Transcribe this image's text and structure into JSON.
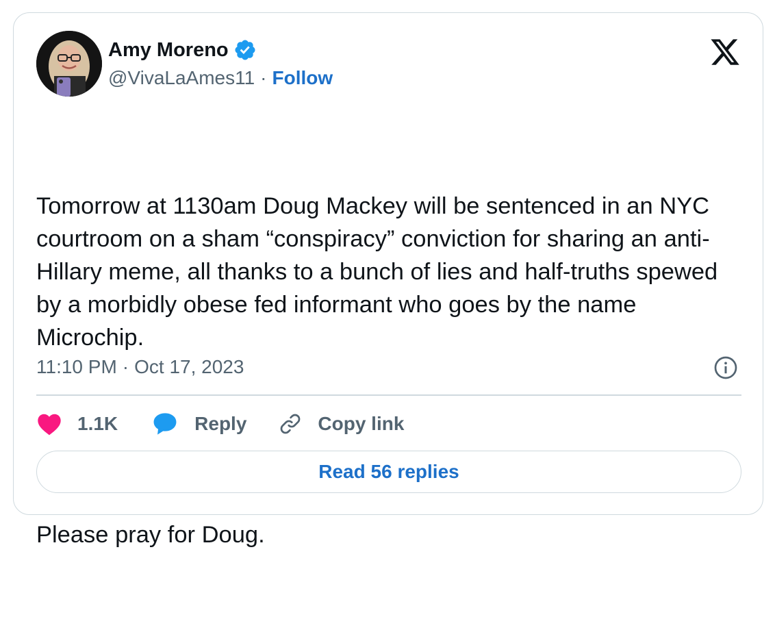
{
  "author": {
    "display_name": "Amy Moreno",
    "handle": "@VivaLaAmes11",
    "separator": "·",
    "follow_label": "Follow",
    "verified": true
  },
  "tweet": {
    "paragraphs": [
      "Tomorrow at 1130am Doug Mackey will be sentenced in an NYC courtroom on a sham “conspiracy” conviction for sharing an anti-Hillary meme, all thanks to a bunch of lies and half-truths spewed by a morbidly obese fed informant who goes by the name Microchip.",
      "Please pray for Doug."
    ],
    "time": "11:10 PM",
    "separator": "·",
    "date": "Oct 17, 2023"
  },
  "actions": {
    "like_count": "1.1K",
    "reply_label": "Reply",
    "copy_link_label": "Copy link"
  },
  "read_replies_label": "Read 56 replies",
  "icons": {
    "verified": "verified-badge-icon",
    "logo": "x-logo-icon",
    "info": "info-icon",
    "like": "heart-icon",
    "reply": "speech-bubble-icon",
    "copy": "link-icon"
  },
  "colors": {
    "text": "#0f1419",
    "secondary": "#536471",
    "link": "#1d70c9",
    "heart": "#f91880",
    "reply_icon": "#1d9bf0",
    "border": "#cfd9de"
  }
}
